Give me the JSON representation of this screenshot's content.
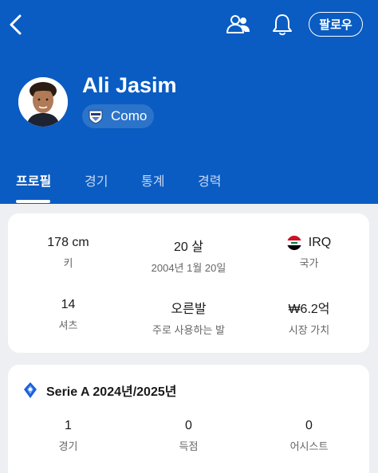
{
  "header": {
    "follow_label": "팔로우",
    "player_name": "Ali Jasim",
    "team_name": "Como"
  },
  "tabs": [
    {
      "label": "프로필",
      "active": true
    },
    {
      "label": "경기",
      "active": false
    },
    {
      "label": "통계",
      "active": false
    },
    {
      "label": "경력",
      "active": false
    }
  ],
  "profile": {
    "height": {
      "value": "178 cm",
      "label": "키"
    },
    "age": {
      "value": "20 살",
      "label": "2004년 1월 20일"
    },
    "country": {
      "value": "IRQ",
      "label": "국가"
    },
    "shirt": {
      "value": "14",
      "label": "셔츠"
    },
    "foot": {
      "value": "오른발",
      "label": "주로 사용하는 발"
    },
    "market_value": {
      "value": "₩6.2억",
      "label": "시장 가치"
    }
  },
  "season": {
    "title": "Serie A 2024년/2025년",
    "stats": [
      {
        "value": "1",
        "label": "경기"
      },
      {
        "value": "0",
        "label": "득점"
      },
      {
        "value": "0",
        "label": "어시스트"
      }
    ]
  },
  "colors": {
    "header_bg": "#0a5cc2",
    "page_bg": "#eeeff3"
  }
}
